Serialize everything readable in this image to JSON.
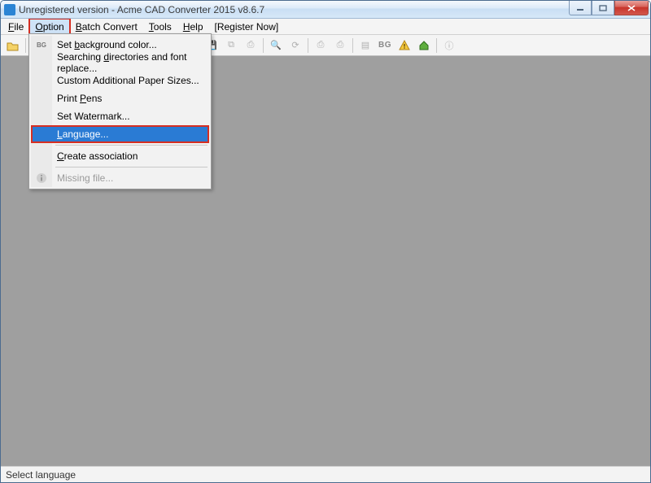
{
  "title": "Unregistered version - Acme CAD Converter 2015 v8.6.7",
  "menubar": {
    "file": "File",
    "option": "Option",
    "batch": "Batch Convert",
    "tools": "Tools",
    "help": "Help",
    "register": "[Register Now]"
  },
  "dropdown": {
    "bg_icon": "BG",
    "set_bg": "Set background color...",
    "search_dir": "Searching directories and font replace...",
    "custom_paper": "Custom Additional Paper Sizes...",
    "print_pens": "Print Pens",
    "set_watermark": "Set Watermark...",
    "language": "Language...",
    "create_assoc": "Create association",
    "missing_file": "Missing file..."
  },
  "statusbar": "Select language",
  "toolbar": {
    "bg_label": "BG"
  }
}
